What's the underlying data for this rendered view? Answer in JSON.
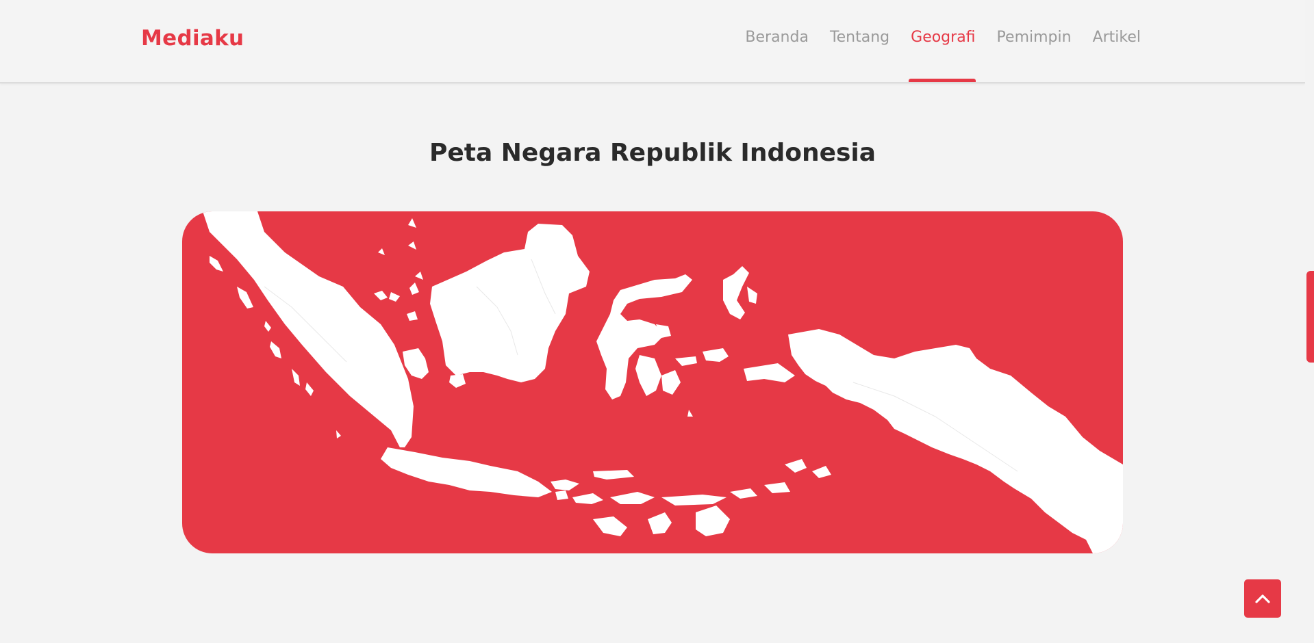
{
  "header": {
    "brand": "Mediaku",
    "nav": [
      {
        "label": "Beranda",
        "active": false
      },
      {
        "label": "Tentang",
        "active": false
      },
      {
        "label": "Geografi",
        "active": true
      },
      {
        "label": "Pemimpin",
        "active": false
      },
      {
        "label": "Artikel",
        "active": false
      }
    ]
  },
  "main": {
    "title": "Peta Negara Republik Indonesia",
    "map_alt": "indonesia-map"
  },
  "back_to_top": {
    "icon": "chevron-up-icon"
  },
  "colors": {
    "accent": "#e63946",
    "background": "#f3f3f3",
    "land": "#ffffff"
  }
}
